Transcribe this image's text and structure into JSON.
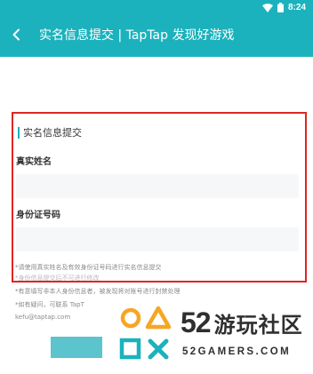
{
  "status_bar": {
    "time": "8:24",
    "icons": [
      "wifi-icon",
      "battery-icon"
    ],
    "bg_color": "#1bb2bd"
  },
  "app_bar": {
    "back_icon": "back-arrow-icon",
    "title": "实名信息提交 | TapTap 发现好游戏",
    "bg_color": "#1bb2bd"
  },
  "form": {
    "section_title": "实名信息提交",
    "name_label": "真实姓名",
    "name_value": "",
    "id_label": "身份证号码",
    "id_value": "",
    "notes": [
      "*请使用真实姓名及有效身份证号码进行实名信息提交",
      "*身份信息提交后不可进行修改",
      "*有意填写非本人身份信息者，被发现将对账号进行封禁处理",
      "*如有疑问，可联系 TapT",
      "kefu@taptap.com"
    ],
    "submit_label": "",
    "accent_color": "#1bb2bd",
    "highlight_color": "#e02424"
  },
  "watermark": {
    "brand_number": "52",
    "brand_text": "游玩社区",
    "domain": "52GAMERS.COM"
  }
}
